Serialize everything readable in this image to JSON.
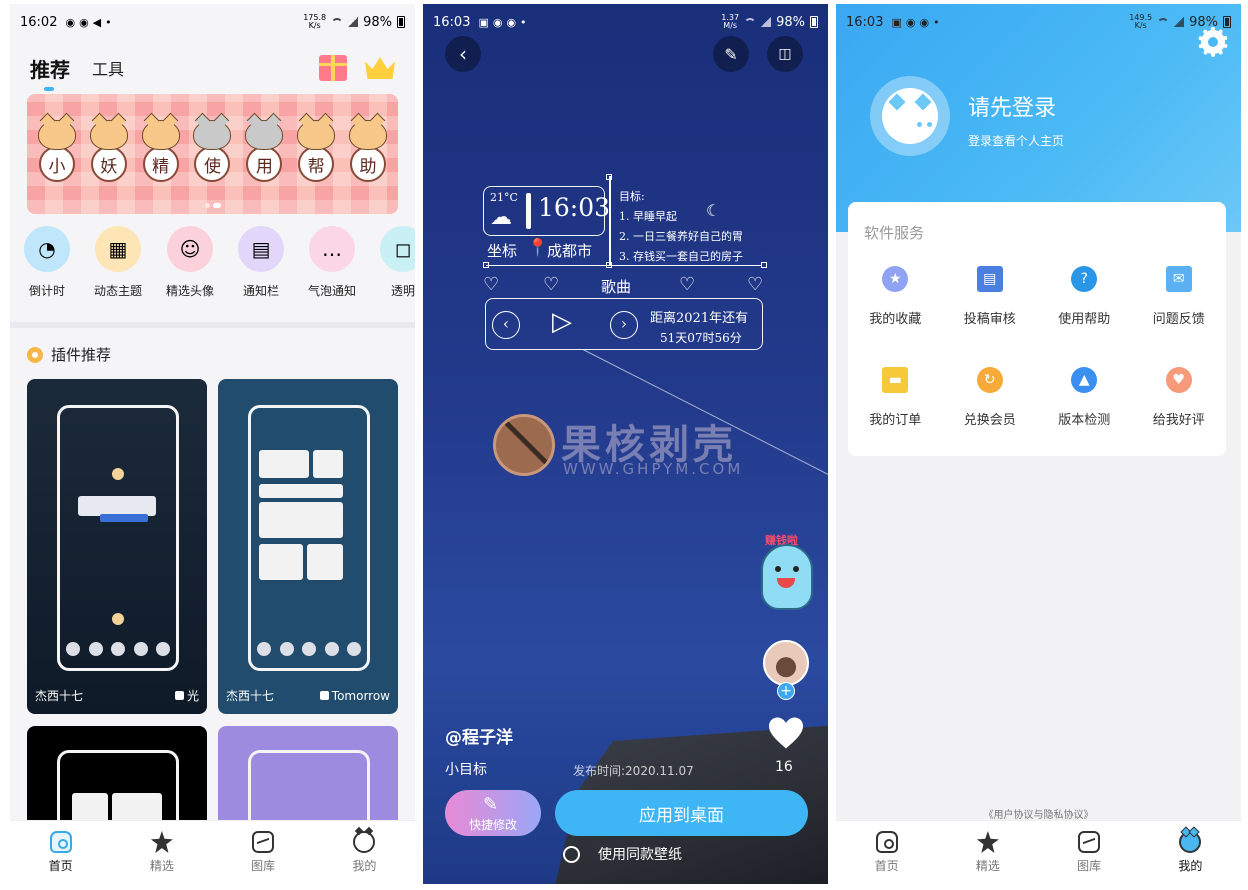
{
  "panel1": {
    "status": {
      "time": "16:02",
      "speed": "175.8\nK/s",
      "battery": "98%"
    },
    "tabs": {
      "active": "推荐",
      "other": "工具"
    },
    "banner_chars": [
      "小",
      "妖",
      "精",
      "使",
      "用",
      "帮",
      "助"
    ],
    "quick_items": [
      {
        "label": "倒计时",
        "color": "#bfe6fb"
      },
      {
        "label": "动态主题",
        "color": "#fde5b5"
      },
      {
        "label": "精选头像",
        "color": "#fbd2dc"
      },
      {
        "label": "通知栏",
        "color": "#e2d7fb"
      },
      {
        "label": "气泡通知",
        "color": "#fbd6e4"
      },
      {
        "label": "透明",
        "color": "#c9f0f5"
      }
    ],
    "section_title": "插件推荐",
    "cards": [
      {
        "author": "杰西十七",
        "like": "光"
      },
      {
        "author": "杰西十七",
        "like": "Tomorrow"
      }
    ],
    "nav": [
      "首页",
      "精选",
      "图库",
      "我的"
    ]
  },
  "panel2": {
    "status": {
      "time": "16:03",
      "speed": "1.37\nM/s",
      "battery": "98%"
    },
    "widget": {
      "temp": "21°C",
      "clock": "16:03",
      "location_label": "坐标",
      "location": "成都市",
      "goal_title": "目标:",
      "goals": [
        "1. 早睡早起",
        "2. 一日三餐养好自己的胃",
        "3. 存钱买一套自己的房子"
      ],
      "song_label": "歌曲",
      "countdown_line1": "距离2021年还有",
      "countdown_line2": "51天07时56分"
    },
    "watermark": {
      "title": "果核剥壳",
      "url": "WWW.GHPYM.COM"
    },
    "mascot_tag": "赚钱啦",
    "user": "@程子洋",
    "desc": "小目标",
    "date": "发布时间:2020.11.07",
    "likes": "16",
    "quick_edit": "快捷修改",
    "apply": "应用到桌面",
    "same_wallpaper": "使用同款壁纸"
  },
  "panel3": {
    "status": {
      "time": "16:03",
      "speed": "149.5\nK/s",
      "battery": "98%"
    },
    "login_title": "请先登录",
    "login_sub": "登录查看个人主页",
    "service_title": "软件服务",
    "services": [
      {
        "label": "我的收藏",
        "color": "#8fa3f2"
      },
      {
        "label": "投稿审核",
        "color": "#4a7fe0"
      },
      {
        "label": "使用帮助",
        "color": "#2a96e8"
      },
      {
        "label": "问题反馈",
        "color": "#5ab0f0"
      },
      {
        "label": "我的订单",
        "color": "#f7c83a"
      },
      {
        "label": "兑换会员",
        "color": "#f7a93a"
      },
      {
        "label": "版本检测",
        "color": "#3a8ff0"
      },
      {
        "label": "给我好评",
        "color": "#f79a7a"
      }
    ],
    "agreement": "《用户协议与隐私协议》",
    "nav": [
      "首页",
      "精选",
      "图库",
      "我的"
    ]
  }
}
